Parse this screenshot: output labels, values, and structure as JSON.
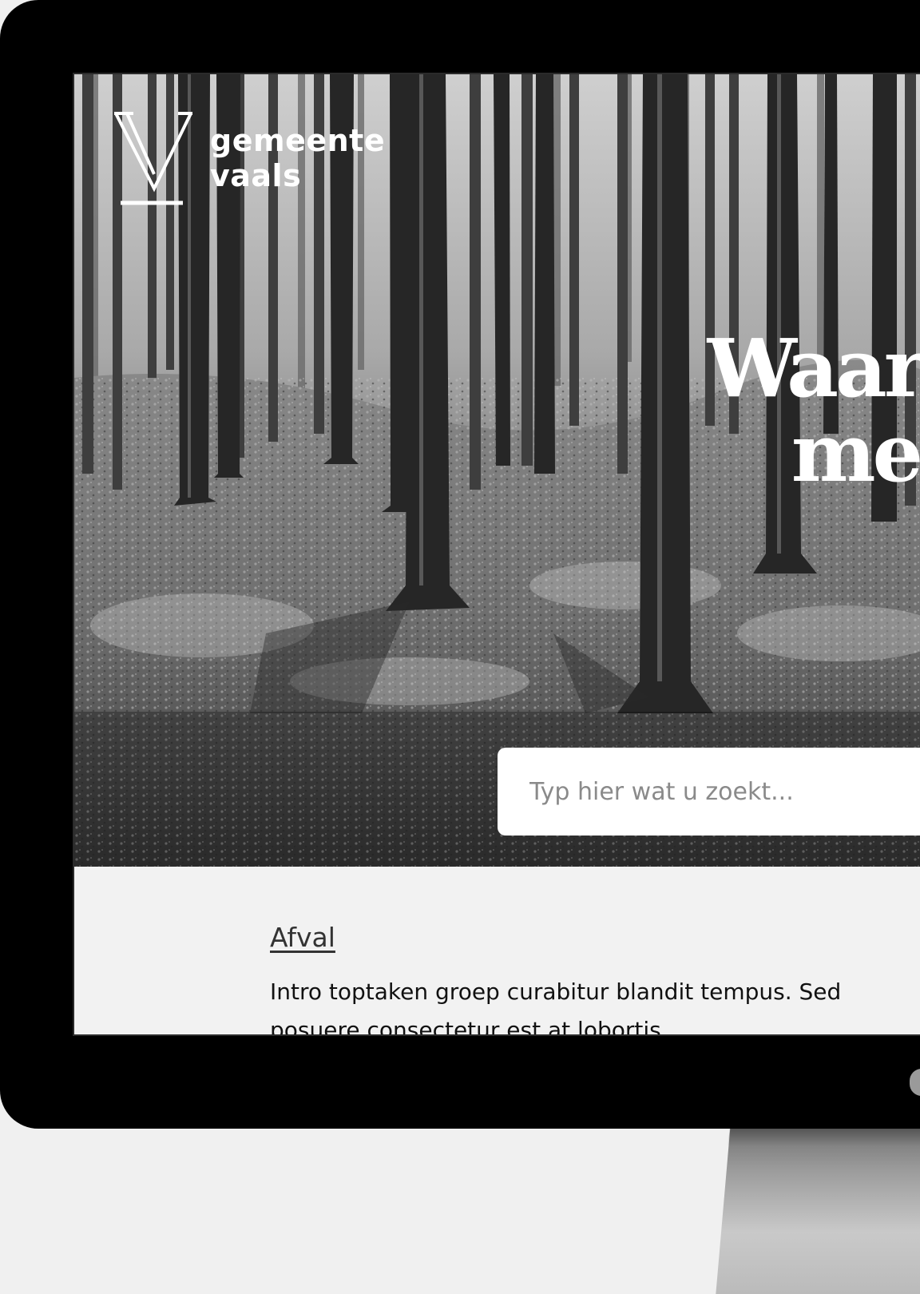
{
  "logo": {
    "line1": "gemeente",
    "line2": "vaals"
  },
  "hero": {
    "headline_line1": "Waar ku",
    "headline_line2": "mee h"
  },
  "search": {
    "placeholder": "Typ hier wat u zoekt..."
  },
  "toptask": {
    "title": "Afval",
    "intro": "Intro toptaken groep curabitur blandit tempus. Sed posuere consectetur est at lobortis."
  }
}
